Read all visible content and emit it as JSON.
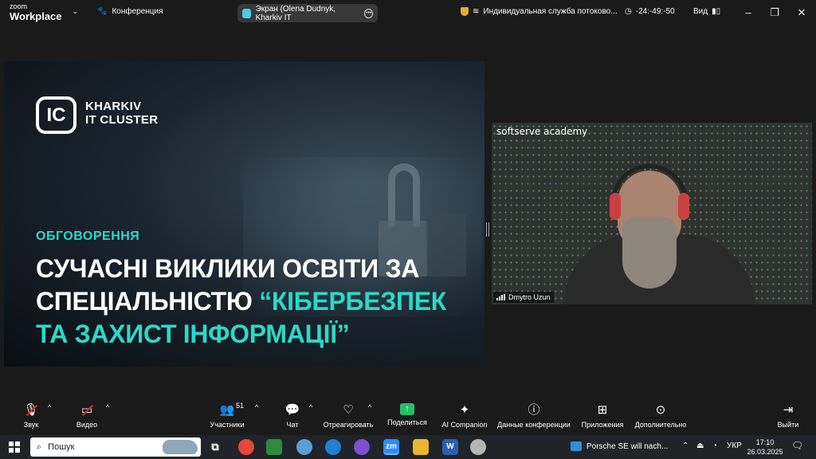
{
  "titlebar": {
    "brand_top": "zoom",
    "brand_bottom": "Workplace",
    "conference_label": "Конференция",
    "screen_label": "Экран (Olena Dudnyk, Kharkiv IT",
    "service_label": "Индивидуальная служба потоково...",
    "timer": "-24:-49:-50",
    "view_label": "Вид"
  },
  "slide": {
    "logo_letters": "IC",
    "org_line1": "KHARKIV",
    "org_line2": "IT CLUSTER",
    "kicker": "ОБГОВОРЕННЯ",
    "headline_line1": "СУЧАСНІ ВИКЛИКИ ОСВІТИ ЗА",
    "headline_line2_prefix": "СПЕЦІАЛЬНІСТЮ ",
    "headline_line2_accent": "“КІБЕРБЕЗПЕК",
    "headline_line3": "ТА ЗАХИСТ ІНФОРМАЦІЇ”",
    "accent_color": "#2bd9c7"
  },
  "video": {
    "background_label": "softserve academy",
    "participant_name": "Dmytro Uzun"
  },
  "toolbar": {
    "audio": "Звук",
    "video": "Видео",
    "participants": "Участники",
    "participants_count": "51",
    "chat": "Чат",
    "react": "Отреагировать",
    "share": "Поделиться",
    "ai": "AI Companion",
    "meeting_info": "Данные конференции",
    "apps": "Приложения",
    "more": "Дополнительно",
    "leave": "Выйти"
  },
  "taskbar": {
    "search_placeholder": "Пошук",
    "notification": "Porsche SE will nach...",
    "language": "УКР",
    "time": "17:10",
    "date": "26.03.2025",
    "zoom_app_label": "zm",
    "word_app_label": "W"
  }
}
